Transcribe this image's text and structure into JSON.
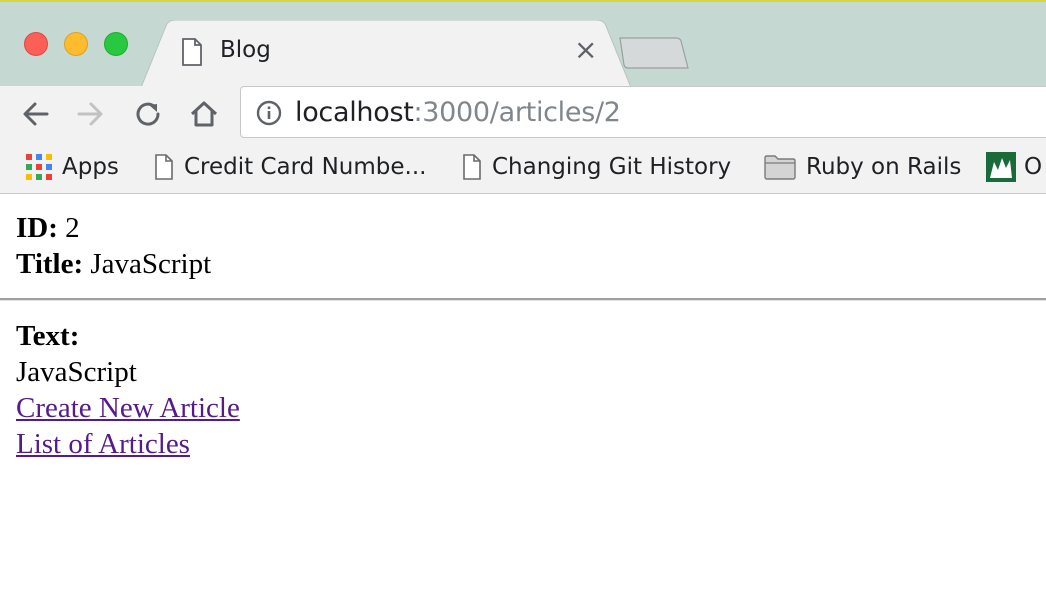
{
  "window": {
    "tab_title": "Blog",
    "tab_close": "×"
  },
  "toolbar": {
    "url_host": "localhost",
    "url_path": ":3000/articles/2"
  },
  "bookmarks": [
    {
      "label": "Apps",
      "icon": "apps-icon"
    },
    {
      "label": "Credit Card Numbe...",
      "icon": "document-icon"
    },
    {
      "label": "Changing Git History",
      "icon": "document-icon"
    },
    {
      "label": "Ruby on Rails",
      "icon": "folder-icon"
    },
    {
      "label": "O",
      "icon": "site-favicon"
    }
  ],
  "article": {
    "id_label": "ID:",
    "id_value": "2",
    "title_label": "Title:",
    "title_value": "JavaScript",
    "text_label": "Text:",
    "text_value": "JavaScript"
  },
  "links": {
    "create": "Create New Article",
    "list": "List of Articles"
  },
  "colors": {
    "link_visited": "#551a8b",
    "traffic_red": "#fc5f57",
    "traffic_yellow": "#fdbc2e",
    "traffic_green": "#28c840",
    "tabstrip_bg": "#c5d8d2"
  }
}
